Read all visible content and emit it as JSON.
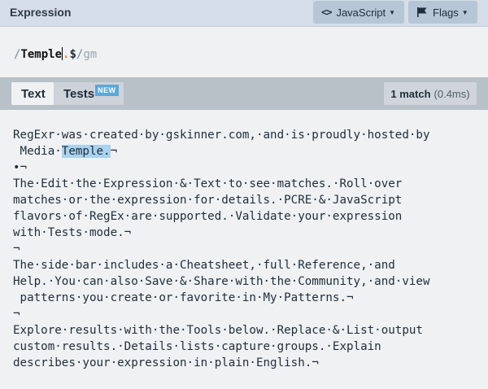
{
  "header": {
    "title": "Expression",
    "language_button": "JavaScript",
    "flags_button": "Flags"
  },
  "expression": {
    "open_delim": "/",
    "literal": "Temple",
    "dot": ".",
    "anchor": "$",
    "close_delim": "/",
    "flags": "gm"
  },
  "tabs": {
    "text": "Text",
    "tests": "Tests",
    "new_badge": "NEW"
  },
  "match_info": {
    "count": "1 match",
    "time": "(0.4ms)"
  },
  "text_lines": [
    {
      "pre": "RegExr·was·created·by·gskinner.com,·and·is·proudly·hosted·by",
      "hl": "",
      "post": ""
    },
    {
      "pre": " Media·",
      "hl": "Temple.",
      "post": "¬"
    },
    {
      "pre": "•¬",
      "hl": "",
      "post": ""
    },
    {
      "pre": "The·Edit·the·Expression·&·Text·to·see·matches.·Roll·over",
      "hl": "",
      "post": ""
    },
    {
      "pre": "matches·or·the·expression·for·details.·PCRE·&·JavaScript",
      "hl": "",
      "post": ""
    },
    {
      "pre": "flavors·of·RegEx·are·supported.·Validate·your·expression",
      "hl": "",
      "post": ""
    },
    {
      "pre": "with·Tests·mode.¬",
      "hl": "",
      "post": ""
    },
    {
      "pre": "¬",
      "hl": "",
      "post": ""
    },
    {
      "pre": "The·side·bar·includes·a·Cheatsheet,·full·Reference,·and",
      "hl": "",
      "post": ""
    },
    {
      "pre": "Help.·You·can·also·Save·&·Share·with·the·Community,·and·view",
      "hl": "",
      "post": ""
    },
    {
      "pre": " patterns·you·create·or·favorite·in·My·Patterns.¬",
      "hl": "",
      "post": ""
    },
    {
      "pre": "¬",
      "hl": "",
      "post": ""
    },
    {
      "pre": "Explore·results·with·the·Tools·below.·Replace·&·List·output",
      "hl": "",
      "post": ""
    },
    {
      "pre": "custom·results.·Details·lists·capture·groups.·Explain",
      "hl": "",
      "post": ""
    },
    {
      "pre": "describes·your·expression·in·plain·English.¬",
      "hl": "",
      "post": ""
    }
  ]
}
